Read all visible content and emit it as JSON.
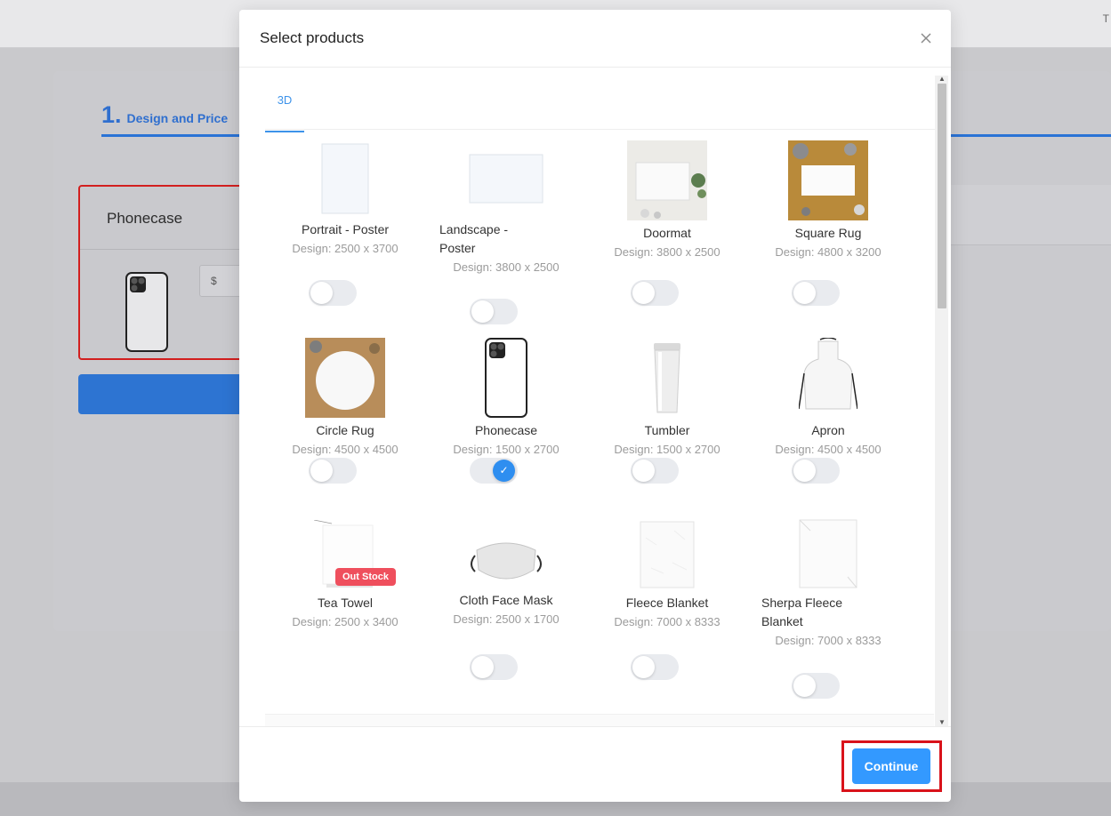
{
  "background": {
    "corner_glyph": "T",
    "step_number": "1.",
    "step_label": "Design and Price",
    "selected_product_title": "Phonecase",
    "price_prefix": "$"
  },
  "modal": {
    "title": "Select products",
    "tabs": [
      {
        "label": "3D"
      }
    ],
    "products": [
      {
        "name": "Portrait - Poster",
        "design": "Design: 2500 x 3700",
        "selected": false
      },
      {
        "name": "Landscape - Poster",
        "design": "Design: 3800 x 2500",
        "selected": false
      },
      {
        "name": "Doormat",
        "design": "Design: 3800 x 2500",
        "selected": false
      },
      {
        "name": "Square Rug",
        "design": "Design: 4800 x 3200",
        "selected": false
      },
      {
        "name": "Circle Rug",
        "design": "Design: 4500 x 4500",
        "selected": false
      },
      {
        "name": "Phonecase",
        "design": "Design: 1500 x 2700",
        "selected": true
      },
      {
        "name": "Tumbler",
        "design": "Design: 1500 x 2700",
        "selected": false
      },
      {
        "name": "Apron",
        "design": "Design: 4500 x 4500",
        "selected": false
      },
      {
        "name": "Tea Towel",
        "design": "Design: 2500 x 3400",
        "badge": "Out Stock",
        "selected": false
      },
      {
        "name": "Cloth Face Mask",
        "design": "Design: 2500 x 1700",
        "selected": false
      },
      {
        "name": "Fleece Blanket",
        "design": "Design: 7000 x 8333",
        "selected": false
      },
      {
        "name": "Sherpa Fleece Blanket",
        "design": "Design: 7000 x 8333",
        "selected": false
      }
    ],
    "continue_label": "Continue",
    "close_icon": "close-icon",
    "toggle_check_glyph": "✓"
  },
  "colors": {
    "accent": "#3399ff",
    "highlight": "#d9121a",
    "badge": "#ef4f5d"
  }
}
